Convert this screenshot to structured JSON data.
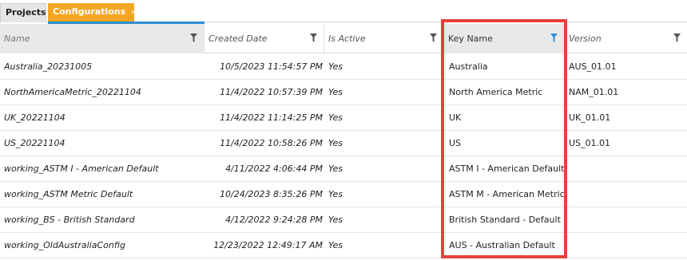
{
  "tabs": [
    {
      "label": "Projects"
    },
    {
      "label": "Configurations",
      "close": "×"
    }
  ],
  "columns": {
    "name": "Name",
    "created_date": "Created Date",
    "is_active": "Is Active",
    "key_name": "Key Name",
    "version": "Version"
  },
  "rows": [
    {
      "name": "Australia_20231005",
      "created_date": "10/5/2023 11:54:57 PM",
      "is_active": "Yes",
      "key_name": "Australia",
      "version": "AUS_01.01"
    },
    {
      "name": "NorthAmericaMetric_20221104",
      "created_date": "11/4/2022 10:57:39 PM",
      "is_active": "Yes",
      "key_name": "North America Metric",
      "version": "NAM_01.01"
    },
    {
      "name": "UK_20221104",
      "created_date": "11/4/2022 11:14:25 PM",
      "is_active": "Yes",
      "key_name": "UK",
      "version": "UK_01.01"
    },
    {
      "name": "US_20221104",
      "created_date": "11/4/2022 10:58:26 PM",
      "is_active": "Yes",
      "key_name": "US",
      "version": "US_01.01"
    },
    {
      "name": "working_ASTM I - American Default",
      "created_date": "4/11/2022 4:06:44 PM",
      "is_active": "Yes",
      "key_name": "ASTM I - American Default",
      "version": ""
    },
    {
      "name": "working_ASTM Metric Default",
      "created_date": "10/24/2023 8:35:26 PM",
      "is_active": "Yes",
      "key_name": "ASTM M - American Metric",
      "version": ""
    },
    {
      "name": "working_BS - British Standard",
      "created_date": "4/12/2022 9:24:28 PM",
      "is_active": "Yes",
      "key_name": "British Standard - Default",
      "version": ""
    },
    {
      "name": "working_OldAustraliaConfig",
      "created_date": "12/23/2022 12:49:17 AM",
      "is_active": "Yes",
      "key_name": "AUS - Australian Default",
      "version": ""
    }
  ],
  "colors": {
    "active_tab": "#f5a623",
    "tab_underline": "#2e8fd6",
    "highlight_border": "#e8403e",
    "filter_active": "#2e8fd6",
    "filter_inactive": "#555555"
  },
  "icons": {
    "filter": "filter-icon",
    "close": "close-icon"
  }
}
